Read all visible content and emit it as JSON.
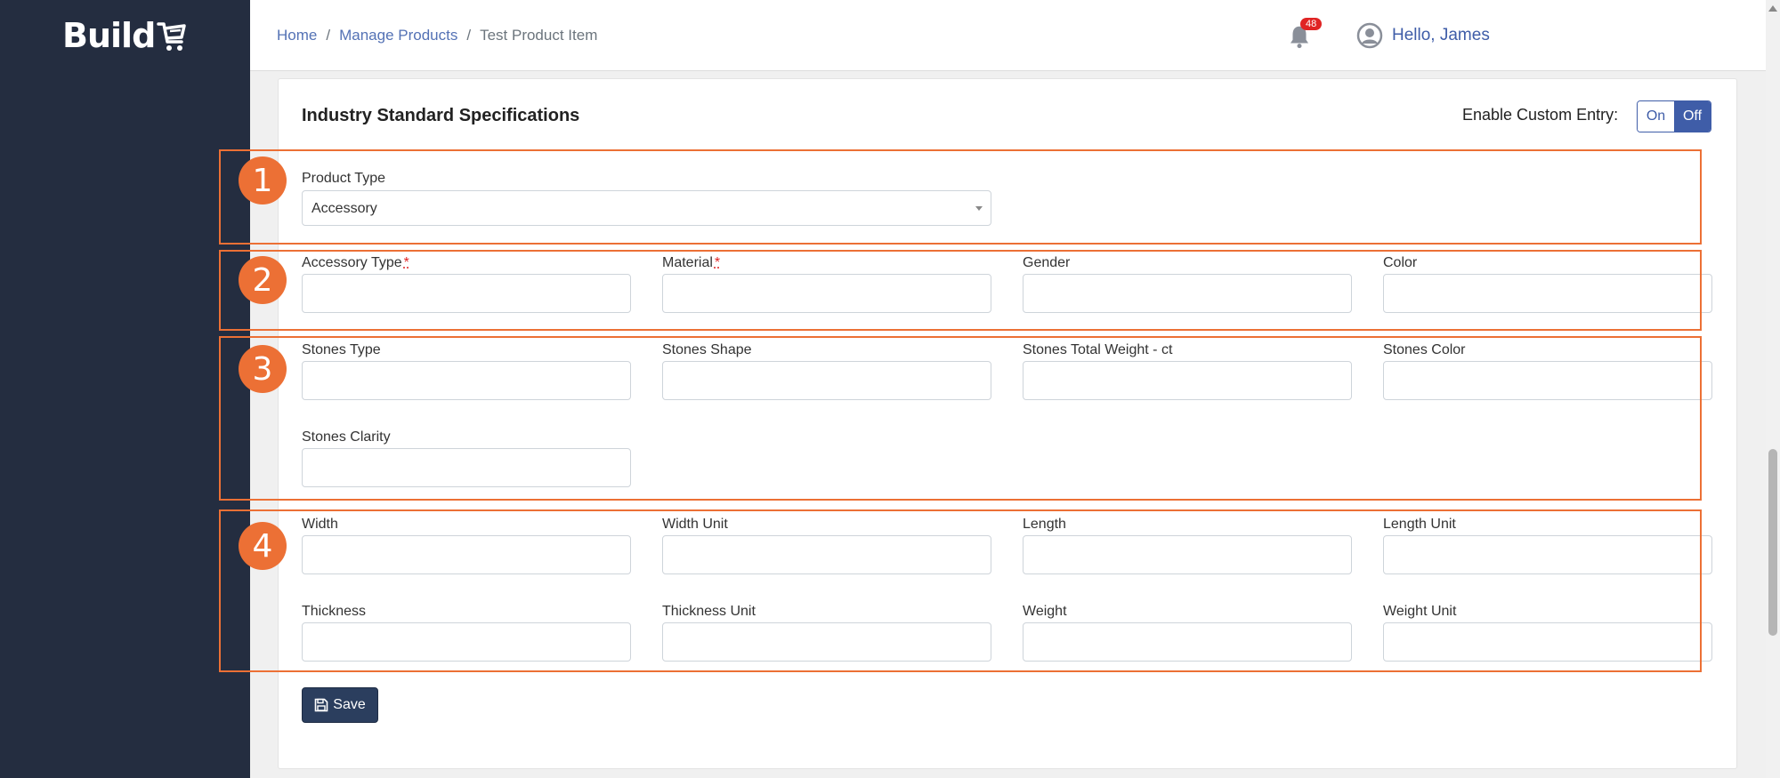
{
  "logo": {
    "text": "Build"
  },
  "breadcrumb": {
    "home": "Home",
    "sep1": "/",
    "products": "Manage Products",
    "sep2": "/",
    "current": "Test Product Item"
  },
  "header": {
    "notification_count": "48",
    "greeting": "Hello, James"
  },
  "card": {
    "title": "Industry Standard Specifications",
    "custom_entry_label": "Enable Custom Entry:",
    "toggle_on": "On",
    "toggle_off": "Off"
  },
  "annotations": {
    "n1": "1",
    "n2": "2",
    "n3": "3",
    "n4": "4"
  },
  "form": {
    "product_type": {
      "label": "Product Type",
      "value": "Accessory"
    },
    "required_mark": "*",
    "fields": {
      "accessory_type": "Accessory Type",
      "material": "Material",
      "gender": "Gender",
      "color": "Color",
      "stones_type": "Stones Type",
      "stones_shape": "Stones Shape",
      "stones_total_weight": "Stones Total Weight - ct",
      "stones_color": "Stones Color",
      "stones_clarity": "Stones Clarity",
      "width": "Width",
      "width_unit": "Width Unit",
      "length": "Length",
      "length_unit": "Length Unit",
      "thickness": "Thickness",
      "thickness_unit": "Thickness Unit",
      "weight": "Weight",
      "weight_unit": "Weight Unit"
    },
    "save_label": "Save"
  },
  "colors": {
    "sidebar": "#242d40",
    "accent": "#3f5da8",
    "annotation": "#ec7035",
    "save": "#2b3e5e"
  }
}
